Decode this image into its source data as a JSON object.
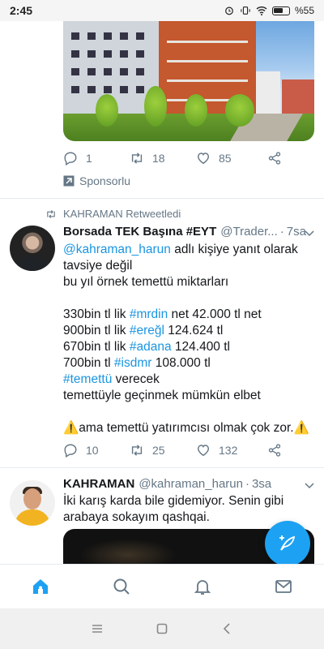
{
  "status_bar": {
    "time": "2:45",
    "battery": "%55"
  },
  "promo_tweet": {
    "replies": "1",
    "retweets": "18",
    "likes": "85",
    "sponsored_label": "Sponsorlu"
  },
  "tweet1": {
    "retweet_by": "KAHRAMAN Retweetledi",
    "name": "Borsada TEK Başına #EYT",
    "handle": "@Trader...",
    "time": "7sa",
    "reply_to_handle": "@kahraman_harun",
    "reply_to_suffix": " adlı kişiye yanıt olarak",
    "lines": {
      "l1": "tavsiye değil",
      "l2": "bu yıl örnek temettü miktarları",
      "l3a": "330bin tl lik ",
      "l3b": "#mrdin",
      "l3c": " net 42.000 tl net",
      "l4a": "900bin tl lik ",
      "l4b": "#ereğl",
      "l4c": " 124.624 tl",
      "l5a": "670bin tl lik ",
      "l5b": "#adana",
      "l5c": " 124.400 tl",
      "l6a": "700bin tl ",
      "l6b": "#isdmr",
      "l6c": " 108.000 tl",
      "l7a": "#temettü",
      "l7b": " verecek",
      "l8": "temettüyle geçinmek mümkün elbet",
      "l9": "⚠️ama temettü yatırımcısı olmak çok zor.⚠️"
    },
    "replies": "10",
    "retweets": "25",
    "likes": "132"
  },
  "tweet2": {
    "name": "KAHRAMAN",
    "handle": "@kahraman_harun",
    "time": "3sa",
    "l1": "İki karış karda bile gidemiyor. Senin gibi",
    "l2": "arabaya sokayım qashqai."
  },
  "colors": {
    "accent": "#1da1f2",
    "link": "#1b95e0",
    "muted": "#657786"
  }
}
